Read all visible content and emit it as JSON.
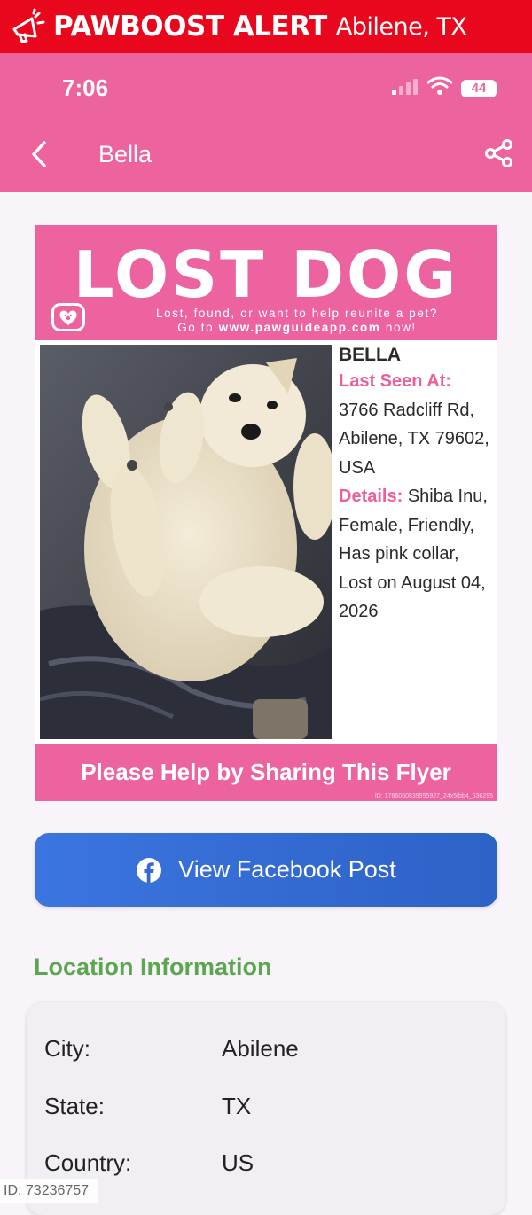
{
  "alert": {
    "brand": "PAWBOOST ALERT",
    "location": "Abilene, TX"
  },
  "status": {
    "time": "7:06",
    "battery": "44"
  },
  "appbar": {
    "title": "Bella"
  },
  "flyer": {
    "title": "LOST DOG",
    "subtitle_line1": "Lost, found, or want to help reunite a pet?",
    "subtitle_line2_pre": "Go to ",
    "subtitle_url": "www.pawguideapp.com",
    "subtitle_line2_post": " now!",
    "pet_name": "BELLA",
    "last_seen_label": "Last Seen At:",
    "last_seen_value": "3766 Radcliff Rd, Abilene, TX 79602, USA",
    "details_label": "Details:",
    "details_value": "Shiba Inu, Female, Friendly, Has pink collar, Lost on August 04, 2026",
    "footer": "Please Help by Sharing This Flyer",
    "flyer_id": "ID: 1786060839955927_24x5fbb4_636295"
  },
  "facebook_button": {
    "label": "View Facebook Post"
  },
  "location_section": {
    "title": "Location Information",
    "rows": [
      {
        "label": "City:",
        "value": "Abilene"
      },
      {
        "label": "State:",
        "value": "TX"
      },
      {
        "label": "Country:",
        "value": "US"
      }
    ]
  },
  "watermark_id": "ID: 73236757",
  "colors": {
    "alert_red": "#e8071d",
    "brand_pink": "#ec639d",
    "facebook_blue": "#3b75e0",
    "section_green": "#5ba74f"
  }
}
